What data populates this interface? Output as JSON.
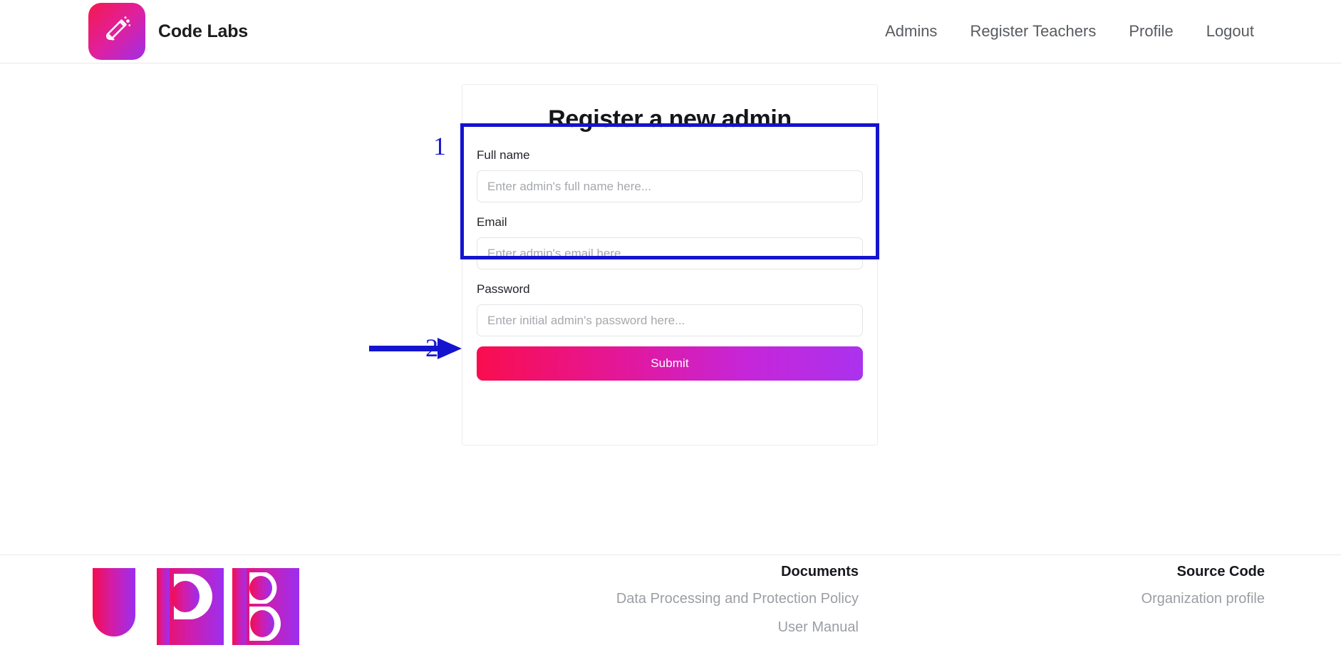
{
  "header": {
    "brand_name": "Code Labs",
    "logo_icon": "test-tube-icon",
    "nav": [
      {
        "label": "Admins"
      },
      {
        "label": "Register Teachers"
      },
      {
        "label": "Profile"
      },
      {
        "label": "Logout"
      }
    ]
  },
  "card": {
    "title": "Register a new admin",
    "fields": [
      {
        "label": "Full name",
        "placeholder": "Enter admin's full name here...",
        "value": ""
      },
      {
        "label": "Email",
        "placeholder": "Enter admin's email here...",
        "value": ""
      },
      {
        "label": "Password",
        "placeholder": "Enter initial admin's password here...",
        "value": ""
      }
    ],
    "submit_label": "Submit"
  },
  "annotations": {
    "step_one": "1",
    "step_two": "2",
    "color": "#1414cf"
  },
  "footer": {
    "logo_text": "UPB",
    "columns": [
      {
        "heading": "Documents",
        "links": [
          {
            "label": "Data Processing and Protection Policy"
          },
          {
            "label": "User Manual"
          }
        ]
      },
      {
        "heading": "Source Code",
        "links": [
          {
            "label": "Organization profile"
          }
        ]
      }
    ]
  },
  "colors": {
    "accent_start": "#fa0d4e",
    "accent_end": "#ab32ee",
    "annotation_blue": "#1414cf"
  }
}
